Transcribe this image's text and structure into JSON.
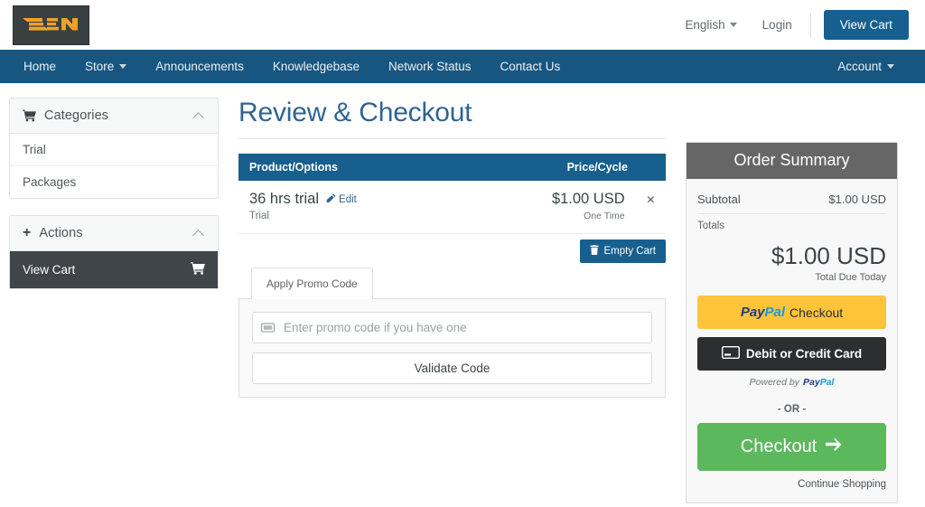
{
  "header": {
    "logo_alt": "TENEA",
    "language": "English",
    "login": "Login",
    "view_cart": "View Cart"
  },
  "nav": {
    "items": [
      {
        "label": "Home",
        "caret": false
      },
      {
        "label": "Store",
        "caret": true
      },
      {
        "label": "Announcements",
        "caret": false
      },
      {
        "label": "Knowledgebase",
        "caret": false
      },
      {
        "label": "Network Status",
        "caret": false
      },
      {
        "label": "Contact Us",
        "caret": false
      }
    ],
    "account": "Account"
  },
  "sidebar": {
    "categories": {
      "title": "Categories",
      "items": [
        "Trial",
        "Packages"
      ]
    },
    "actions": {
      "title": "Actions",
      "view_cart": "View Cart"
    }
  },
  "main": {
    "title": "Review & Checkout",
    "table": {
      "columns": [
        "Product/Options",
        "Price/Cycle"
      ],
      "rows": [
        {
          "product": "36 hrs trial",
          "edit": "Edit",
          "option": "Trial",
          "price": "$1.00 USD",
          "cycle": "One Time",
          "remove": "×"
        }
      ]
    },
    "empty_cart": "Empty Cart",
    "promo": {
      "tab": "Apply Promo Code",
      "placeholder": "Enter promo code if you have one",
      "value": "",
      "validate": "Validate Code"
    }
  },
  "summary": {
    "title": "Order Summary",
    "subtotal_label": "Subtotal",
    "subtotal_value": "$1.00 USD",
    "totals_label": "Totals",
    "total_amount": "$1.00 USD",
    "total_caption": "Total Due Today",
    "paypal_pay": "Pay",
    "paypal_pal": "Pal",
    "paypal_checkout": "Checkout",
    "debit_card": "Debit or Credit Card",
    "powered_by": "Powered by",
    "powered_pay": "Pay",
    "powered_pal": "Pal",
    "or": "- OR -",
    "checkout": "Checkout",
    "continue_shopping": "Continue Shopping"
  },
  "colors": {
    "nav_blue": "#175680",
    "accent_blue": "#175f8e",
    "title_blue": "#2f6491",
    "summary_gray": "#666666",
    "paypal_yellow": "#ffc439",
    "checkout_green": "#5cb85c",
    "logo_orange": "#f0a029",
    "dark_slate": "#3f4549"
  }
}
